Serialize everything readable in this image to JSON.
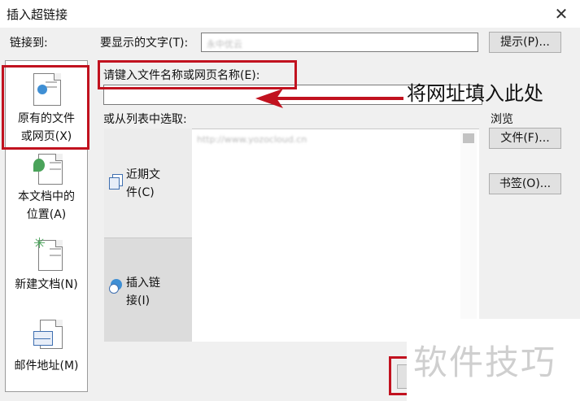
{
  "dialog": {
    "title": "插入超链接",
    "close_glyph": "✕"
  },
  "top": {
    "link_to_label": "链接到:",
    "display_text_label": "要显示的文字(T):",
    "display_text_value": "永中优云",
    "tip_button": "提示(P)..."
  },
  "address": {
    "label": "请键入文件名称或网页名称(E):",
    "value": ""
  },
  "list": {
    "select_label": "或从列表中选取:",
    "browse_label": "浏览",
    "items": [
      "http://www.yozocloud.cn"
    ]
  },
  "left_nav": {
    "items": [
      {
        "label_line1": "原有的文件",
        "label_line2": "或网页(X)",
        "icon": "web-page-icon"
      },
      {
        "label_line1": "本文档中的",
        "label_line2": "位置(A)",
        "icon": "document-place-icon"
      },
      {
        "label_line1": "新建文档(N)",
        "label_line2": "",
        "icon": "new-document-icon"
      },
      {
        "label_line1": "邮件地址(M)",
        "label_line2": "",
        "icon": "mail-address-icon"
      }
    ]
  },
  "mid_nav": {
    "recent": {
      "line1": "近期文",
      "line2": "件(C)",
      "icon": "recent-files-icon"
    },
    "inserted": {
      "line1": "插入链",
      "line2": "接(I)",
      "icon": "inserted-links-icon"
    }
  },
  "side_buttons": {
    "file": "文件(F)...",
    "bookmark": "书签(O)..."
  },
  "annotation": {
    "text": "将网址填入此处"
  },
  "watermark": {
    "text": "软件技巧"
  },
  "colors": {
    "highlight_red": "#c1121f",
    "dialog_bg": "#f0f0f0"
  }
}
